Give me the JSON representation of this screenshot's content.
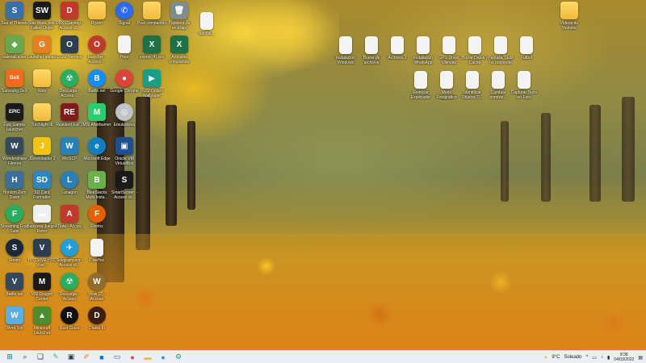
{
  "desktop": {
    "icons": [
      {
        "label": "Sea of Thieves",
        "kind": "app",
        "color": "#3a6fa8",
        "glyph": "S"
      },
      {
        "label": "Star Wars Jedi: Fallen Order",
        "kind": "app",
        "color": "#1a1a1a",
        "glyph": "SW"
      },
      {
        "label": "DBXSGaming - Acceso di...",
        "kind": "app",
        "color": "#c0392b",
        "glyph": "D"
      },
      {
        "label": "Ryzen",
        "kind": "folder"
      },
      {
        "label": "Signal",
        "kind": "app",
        "color": "#2c6bed",
        "glyph": "✆",
        "round": true
      },
      {
        "label": "Post compartido",
        "kind": "folder"
      },
      {
        "label": "Papelera de reciclaje",
        "kind": "app",
        "color": "#7f8c8d",
        "glyph": "🗑"
      },
      {
        "label": "tutorial...",
        "kind": "doc"
      },
      {
        "label": "Vídeos de Youtube",
        "kind": "folder"
      },
      {
        "label": "balenaEtcher",
        "kind": "app",
        "color": "#6aa84f",
        "glyph": "◆"
      },
      {
        "label": "Launcher impact",
        "kind": "app",
        "color": "#e67e22",
        "glyph": "G"
      },
      {
        "label": "OGM Hermes",
        "kind": "app",
        "color": "#2c3e50",
        "glyph": "O"
      },
      {
        "label": "launcher - Acceso ...",
        "kind": "app",
        "color": "#c0392b",
        "glyph": "O",
        "round": true
      },
      {
        "label": "Hoja",
        "kind": "doc"
      },
      {
        "label": "export (4).csv",
        "kind": "app",
        "color": "#1e7145",
        "glyph": "X"
      },
      {
        "label": "Artículos compartido",
        "kind": "app",
        "color": "#1e7145",
        "glyph": "X"
      },
      {
        "label": "Samsung DeX",
        "kind": "app",
        "color": "#f26b1d",
        "glyph": "DeX"
      },
      {
        "label": "Web",
        "kind": "folder"
      },
      {
        "label": "Descarga - Acceso ...",
        "kind": "app",
        "color": "#27ae60",
        "glyph": "☢",
        "round": true
      },
      {
        "label": "Battle.net",
        "kind": "app",
        "color": "#148eff",
        "glyph": "B",
        "round": true
      },
      {
        "label": "Google Chrome",
        "kind": "app",
        "color": "#db4437",
        "glyph": "●",
        "round": true
      },
      {
        "label": "PUSH Video Wallpaper",
        "kind": "app",
        "color": "#16a085",
        "glyph": "▶"
      },
      {
        "label": "Epic Games Launcher",
        "kind": "app",
        "color": "#1b1b1b",
        "glyph": "EPIC"
      },
      {
        "label": "Torchlight III",
        "kind": "folder"
      },
      {
        "label": "Resident Evil 3",
        "kind": "app",
        "color": "#7f1d1d",
        "glyph": "RE"
      },
      {
        "label": "MSI Afterburner",
        "kind": "app",
        "color": "#2ecc71",
        "glyph": "M"
      },
      {
        "label": "Emuladores",
        "kind": "app",
        "color": "#bdc3c7",
        "glyph": "◎",
        "round": true
      },
      {
        "label": "Wondershare Filmora",
        "kind": "app",
        "color": "#34495e",
        "glyph": "W"
      },
      {
        "label": "JDownloader 2",
        "kind": "app",
        "color": "#f1c40f",
        "glyph": "J"
      },
      {
        "label": "WinSCP",
        "kind": "app",
        "color": "#2980b9",
        "glyph": "W"
      },
      {
        "label": "Microsoft Edge",
        "kind": "app",
        "color": "#0f7fbf",
        "glyph": "e",
        "round": true
      },
      {
        "label": "Oracle VM VirtualBox",
        "kind": "app",
        "color": "#1d4f91",
        "glyph": "▣"
      },
      {
        "label": "Horizon Zero Dawn",
        "kind": "app",
        "color": "#3b6f9a",
        "glyph": "H"
      },
      {
        "label": "SD Card Formatter",
        "kind": "app",
        "color": "#2e86c1",
        "glyph": "SD"
      },
      {
        "label": "Lanagon",
        "kind": "app",
        "color": "#2980b9",
        "glyph": "L",
        "round": true
      },
      {
        "label": "BlueStacks Multi-Insta...",
        "kind": "app",
        "color": "#6ab04c",
        "glyph": "B"
      },
      {
        "label": "SmartScreen - Acceso di...",
        "kind": "app",
        "color": "#1a1a1a",
        "glyph": "S"
      },
      {
        "label": "Streaming Frog Suite",
        "kind": "app",
        "color": "#27ae60",
        "glyph": "F",
        "round": true
      },
      {
        "label": "Batocera Juegos Retro",
        "kind": "app",
        "color": "#ecf0f1",
        "glyph": "▬"
      },
      {
        "label": "ATIate - Acces...",
        "kind": "app",
        "color": "#c0392b",
        "glyph": "A"
      },
      {
        "label": "Firefox",
        "kind": "app",
        "color": "#e66000",
        "glyph": "F",
        "round": true
      },
      {
        "label": "Steam",
        "kind": "app",
        "color": "#1b2838",
        "glyph": "S",
        "round": true
      },
      {
        "label": "HTC VIVE HTC Vive...",
        "kind": "app",
        "color": "#2c3e50",
        "glyph": "V"
      },
      {
        "label": "Telegramcom - Acceso di...",
        "kind": "app",
        "color": "#229ed9",
        "glyph": "✈",
        "round": true
      },
      {
        "label": "Diseños",
        "kind": "doc"
      },
      {
        "label": "Battle.net",
        "kind": "app",
        "color": "#34495e",
        "glyph": "V"
      },
      {
        "label": "MSI Dragon Center",
        "kind": "app",
        "color": "#1a1a1a",
        "glyph": "M"
      },
      {
        "label": "Descarga - Acceso",
        "kind": "app",
        "color": "#27ae60",
        "glyph": "☢",
        "round": true
      },
      {
        "label": "Wow (2) - Acceso",
        "kind": "app",
        "color": "#8e6d2e",
        "glyph": "W",
        "round": true
      },
      {
        "label": "Word Top",
        "kind": "app",
        "color": "#5dade2",
        "glyph": "W"
      },
      {
        "label": "Minecraft Launcher",
        "kind": "app",
        "color": "#4e8d2d",
        "glyph": "▲"
      },
      {
        "label": "Rust Class",
        "kind": "app",
        "color": "#111111",
        "glyph": "R",
        "round": true
      },
      {
        "label": "Diablo III",
        "kind": "app",
        "color": "#3e1f10",
        "glyph": "D",
        "round": true
      }
    ],
    "right_icons": [
      {
        "label": "Instalación Windows",
        "kind": "doc"
      },
      {
        "label": "Borrar de archivos",
        "kind": "doc"
      },
      {
        "label": "Archivos 2",
        "kind": "doc"
      },
      {
        "label": "Instalación WhatsApp",
        "kind": "doc"
      },
      {
        "label": "GPU Driver Ultimate",
        "kind": "doc"
      },
      {
        "label": "Borrar Datos y Caché",
        "kind": "doc"
      },
      {
        "label": "Pantalla Táctil no responde",
        "kind": "doc"
      },
      {
        "label": "Fútbol",
        "kind": "doc"
      },
      {
        "label": "Reiniciar Explorador",
        "kind": "doc"
      },
      {
        "label": "Modo Fotográfico Digital",
        "kind": "doc"
      },
      {
        "label": "Identificar Objetos D...",
        "kind": "doc"
      },
      {
        "label": "Cambiar nombre...",
        "kind": "doc"
      },
      {
        "label": "Capturar Texto en Foto",
        "kind": "doc"
      }
    ]
  },
  "taskbar": {
    "items": [
      {
        "name": "start-button",
        "glyph": "⊞",
        "color": "#0078d4"
      },
      {
        "name": "search-button",
        "glyph": "⌕",
        "color": "#333333"
      },
      {
        "name": "task-view-button",
        "glyph": "❏",
        "color": "#333333"
      },
      {
        "name": "app-notepad",
        "glyph": "✎",
        "color": "#2ecc71"
      },
      {
        "name": "app-terminal",
        "glyph": "▣",
        "color": "#2c3e50"
      },
      {
        "name": "app-paint",
        "glyph": "✐",
        "color": "#e67e22"
      },
      {
        "name": "app-store",
        "glyph": "■",
        "color": "#0078d4"
      },
      {
        "name": "app-mail",
        "glyph": "▭",
        "color": "#3b5998"
      },
      {
        "name": "app-chrome",
        "glyph": "●",
        "color": "#db4437"
      },
      {
        "name": "app-explorer",
        "glyph": "▬",
        "color": "#f0b93a"
      },
      {
        "name": "app-chrome-2",
        "glyph": "●",
        "color": "#4285f4"
      },
      {
        "name": "app-settings",
        "glyph": "⚙",
        "color": "#16a085"
      }
    ],
    "weather": {
      "temp": "9°C",
      "condition": "Soleado"
    },
    "clock": {
      "time": "8:38",
      "date": "04/03/2022"
    }
  }
}
